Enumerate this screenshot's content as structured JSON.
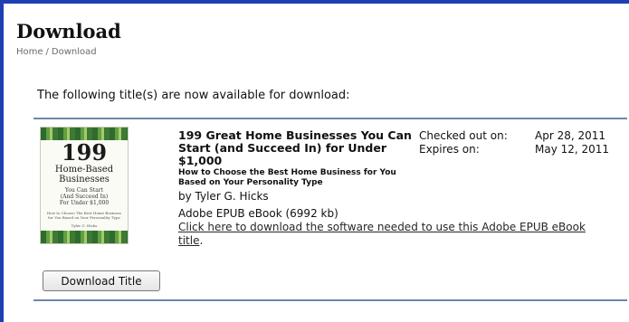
{
  "page": {
    "title": "Download",
    "breadcrumb": [
      "Home",
      "Download"
    ],
    "breadcrumb_separator": "/",
    "intro": "The following title(s) are now available for download:"
  },
  "book": {
    "cover": {
      "number": "199",
      "line1": "Home-Based",
      "line2": "Businesses",
      "line3": "You Can Start",
      "line4": "(And Succeed In)",
      "line5": "For Under $1,000",
      "line6": "How to Choose The Best Home Business for You Based on Your Personality Type",
      "line7": "Tyler G. Hicks"
    },
    "title": "199 Great Home Businesses You Can Start (and Succeed In) for Under $1,000",
    "subtitle": "How to Choose the Best Home Business for You Based on Your Personality Type",
    "author": "by Tyler G. Hicks",
    "format": "Adobe EPUB eBook (6992 kb)",
    "software_link": "Click here to download the software needed to use this Adobe EPUB eBook title",
    "software_link_suffix": "."
  },
  "loan": {
    "checked_out_label": "Checked out on:",
    "checked_out_value": "Apr 28, 2011",
    "expires_label": "Expires on:",
    "expires_value": "May 12, 2011"
  },
  "actions": {
    "download_label": "Download Title"
  },
  "colors": {
    "frame_border": "#1f3fb5",
    "rule": "#6e86ad"
  }
}
